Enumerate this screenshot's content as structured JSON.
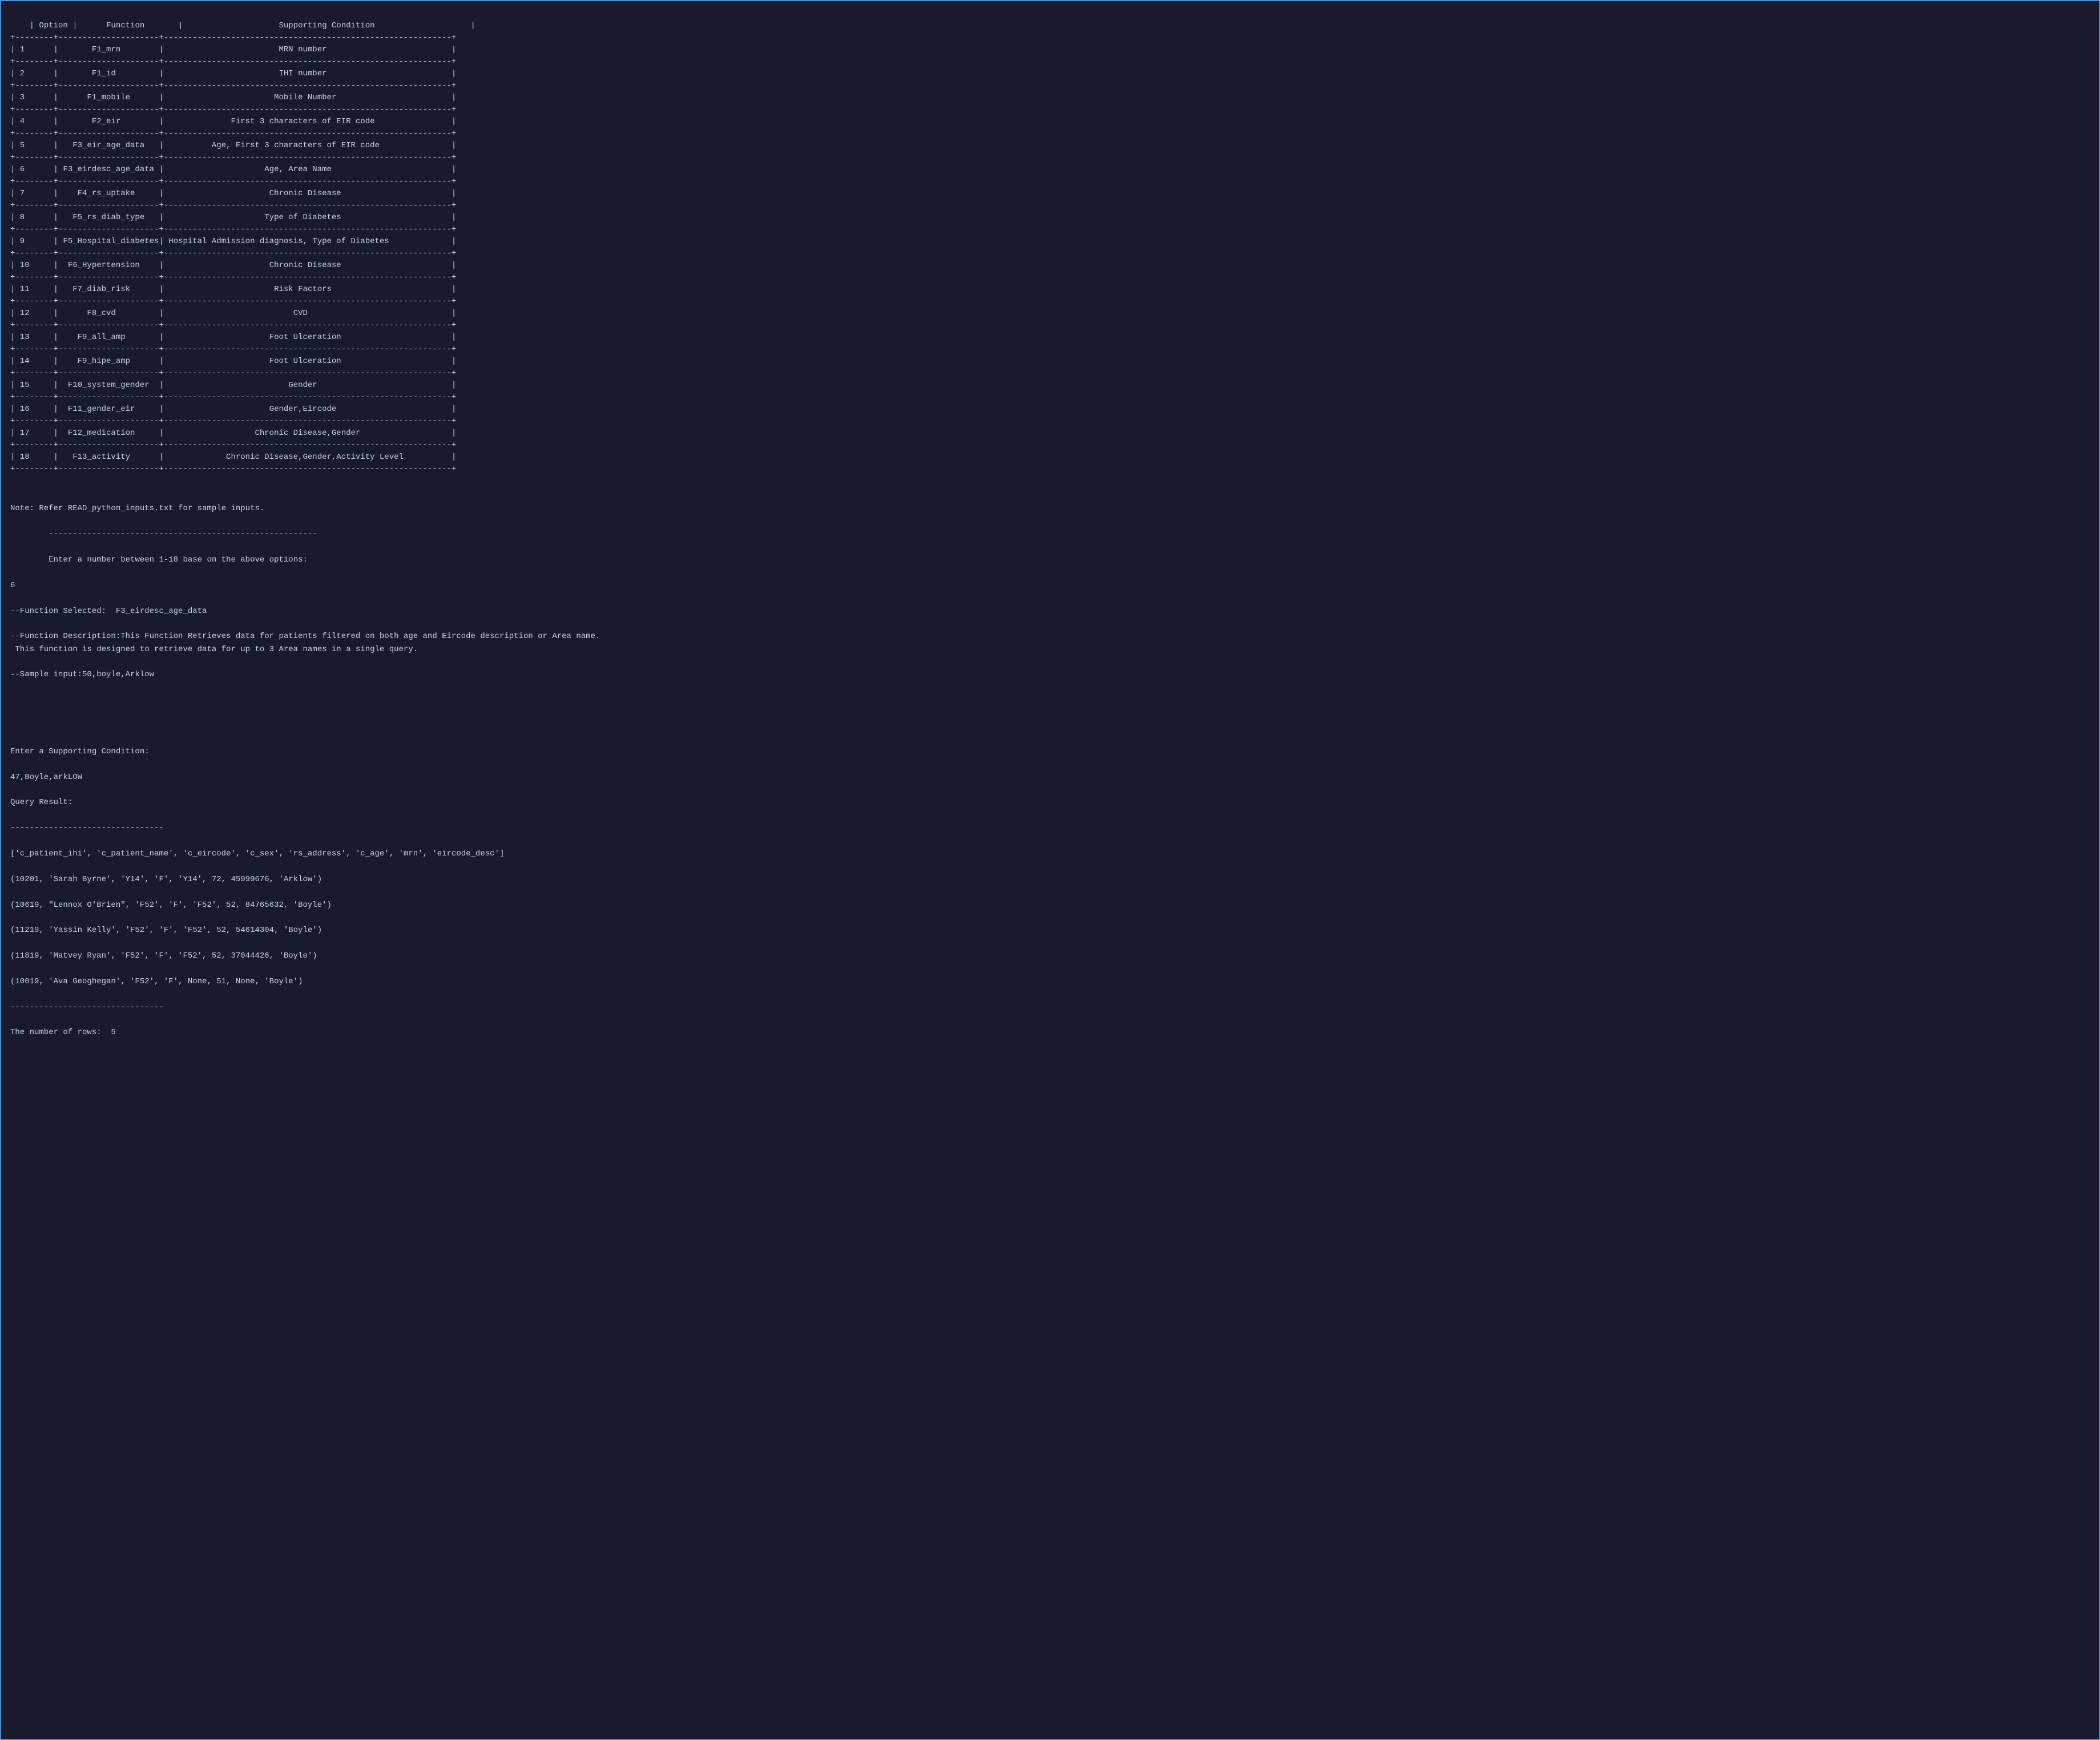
{
  "terminal": {
    "background": "#1a1a2e",
    "border_color": "#4a90d9",
    "text_color": "#c8d0e0"
  },
  "table": {
    "header": "| Option |      Function       |                    Supporting Condition                    |",
    "separator": "+--------+---------------------+------------------------------------------------------------+",
    "rows": [
      "| 1      |       F1_mrn        |                        MRN number                          |",
      "| 2      |       F1_id         |                        IHI number                          |",
      "| 3      |      F1_mobile      |                       Mobile Number                        |",
      "| 4      |       F2_eir        |              First 3 characters of EIR code                |",
      "| 5      |   F3_eir_age_data   |          Age, First 3 characters of EIR code               |",
      "| 6      | F3_eirdesc_age_data |                     Age, Area Name                         |",
      "| 7      |    F4_rs_uptake     |                      Chronic Disease                       |",
      "| 8      |   F5_rs_diab_type   |                     Type of Diabetes                       |",
      "| 9      | F5_Hospital_diabetes| Hospital Admission diagnosis, Type of Diabetes             |",
      "| 10     |  F6_Hypertension    |                      Chronic Disease                       |",
      "| 11     |   F7_diab_risk      |                       Risk Factors                         |",
      "| 12     |      F8_cvd         |                           CVD                              |",
      "| 13     |    F9_all_amp       |                      Foot Ulceration                       |",
      "| 14     |    F9_hipe_amp      |                      Foot Ulceration                       |",
      "| 15     |  F10_system_gender  |                          Gender                            |",
      "| 16     |  F11_gender_eir     |                      Gender,Eircode                        |",
      "| 17     |  F12_medication     |                   Chronic Disease,Gender                   |",
      "| 18     |   F13_activity      |             Chronic Disease,Gender,Activity Level          |"
    ]
  },
  "output": {
    "note": "Note: Refer READ_python_inputs.txt for sample inputs.",
    "separator1": "        --------------------------------------------------------",
    "prompt": "        Enter a number between 1-18 base on the above options:",
    "user_input": "6",
    "function_selected": "--Function Selected:  F3_eirdesc_age_data",
    "function_description": "--Function Description:This Function Retrieves data for patients filtered on both age and Eircode description or Area name.\n This function is designed to retrieve data for up to 3 Area names in a single query.",
    "sample_input": "--Sample input:50,boyle,Arklow",
    "blank_line": "",
    "blank_line2": "",
    "enter_condition": "Enter a Supporting Condition:",
    "condition_input": "47,Boyle,arkLOW",
    "query_result_label": "Query Result:",
    "separator2": "--------------------------------",
    "result_header": "['c_patient_ihi', 'c_patient_name', 'c_eircode', 'c_sex', 'rs_address', 'c_age', 'mrn', 'eircode_desc']",
    "result_rows": [
      "(10201, 'Sarah Byrne', 'Y14', 'F', 'Y14', 72, 45999676, 'Arklow')",
      "(10619, \"Lennox O'Brien\", 'F52', 'F', 'F52', 52, 84765632, 'Boyle')",
      "(11219, 'Yassin Kelly', 'F52', 'F', 'F52', 52, 54614304, 'Boyle')",
      "(11819, 'Matvey Ryan', 'F52', 'F', 'F52', 52, 37044426, 'Boyle')",
      "(10019, 'Ava Geoghegan', 'F52', 'F', None, 51, None, 'Boyle')"
    ],
    "separator3": "--------------------------------",
    "row_count": "The number of rows:  5"
  }
}
